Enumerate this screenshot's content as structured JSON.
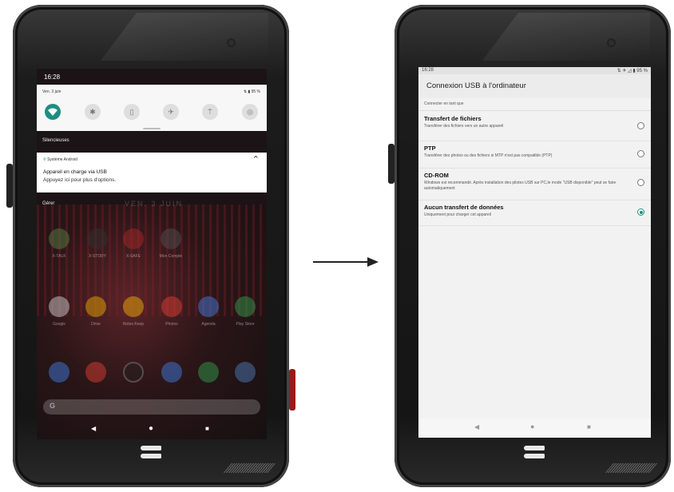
{
  "left_phone": {
    "time": "16:28",
    "quick_settings": {
      "date": "Ven. 3 juin",
      "status": "⇅ ▮ 95 %",
      "icons": [
        "wifi-icon",
        "bluetooth-icon",
        "battery-saver-icon",
        "airplane-icon",
        "flashlight-icon",
        "hotspot-icon"
      ]
    },
    "section_silent": "Silencieuses",
    "notification": {
      "source": "Système Android",
      "title": "Appareil en charge via USB",
      "body": "Appuyez ici pour plus d'options."
    },
    "manage_label": "Gérer",
    "lock_date": "VEN. 3 JUIN",
    "apps_row1": [
      "X-TALK",
      "X-STORY",
      "X-SAFE",
      "Mon Compte"
    ],
    "apps_row2": [
      "Google",
      "Drive",
      "Notes Keep",
      "Photos",
      "Agenda",
      "Play Store"
    ],
    "dock_apps": [
      "phone-icon",
      "chrome-icon",
      "camera-icon",
      "messages-icon",
      "settings-icon",
      "gallery-icon"
    ],
    "search_letter": "G",
    "nav": {
      "back": "◀",
      "home": "●",
      "recents": "■"
    }
  },
  "right_phone": {
    "status_time": "16:28",
    "status_icons": "⇅ ✈ ◿ ▮ 95 %",
    "title": "Connexion USB à l'ordinateur",
    "subheader": "Connecter en tant que",
    "options": [
      {
        "title": "Transfert de fichiers",
        "desc": "Transférer des fichiers vers un autre appareil",
        "selected": false
      },
      {
        "title": "PTP",
        "desc": "Transférer des photos ou des fichiers si MTP n'est pas compatible (PTP)",
        "selected": false
      },
      {
        "title": "CD-ROM",
        "desc": "Windows est recommandé. Après installation des pilotes USB sur PC,le mode \"USB disponible\" peut se faire automatiquement",
        "selected": false
      },
      {
        "title": "Aucun transfert de données",
        "desc": "Uniquement pour charger cet appareil",
        "selected": true
      }
    ],
    "nav": {
      "back": "◀",
      "home": "●",
      "recents": "■"
    }
  },
  "colors": {
    "accent": "#1e8e82",
    "device_body": "#1a1a1a"
  }
}
